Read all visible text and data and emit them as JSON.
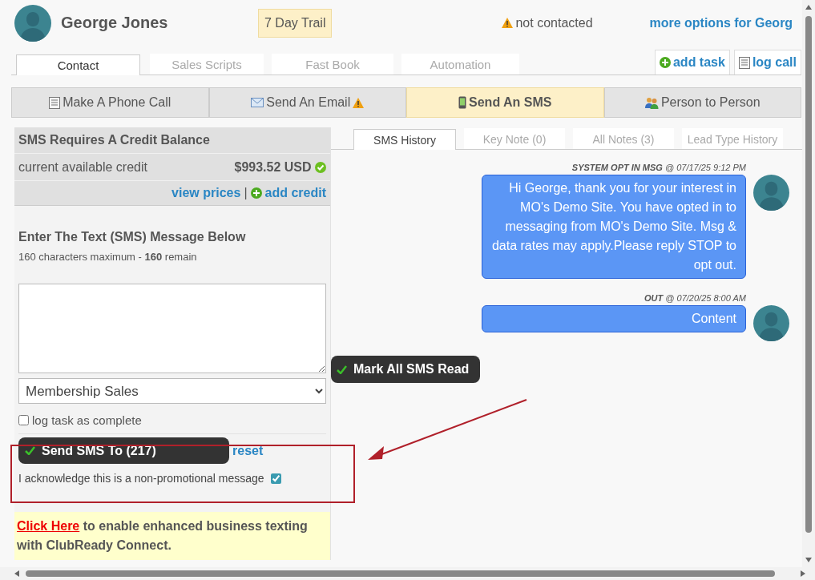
{
  "contact": {
    "name": "George Jones",
    "status_badge": "7 Day Trail",
    "contact_status": "not contacted",
    "more_options_link": "more options for Georg"
  },
  "tabs": [
    {
      "label": "Contact",
      "selected": true
    },
    {
      "label": "Sales Scripts",
      "selected": false
    },
    {
      "label": "Fast Book",
      "selected": false
    },
    {
      "label": "Automation",
      "selected": false
    }
  ],
  "quick_actions": [
    {
      "label": "add task",
      "kind": "add"
    },
    {
      "label": "log call",
      "kind": "log"
    }
  ],
  "action_bar": [
    {
      "label": "Make A Phone Call",
      "kind": "phone",
      "selected": false,
      "warning": false
    },
    {
      "label": "Send An Email",
      "kind": "email",
      "selected": false,
      "warning": true
    },
    {
      "label": "Send An SMS",
      "kind": "sms",
      "selected": true,
      "warning": false
    },
    {
      "label": "Person to Person",
      "kind": "person",
      "selected": false,
      "warning": false
    }
  ],
  "credit": {
    "title": "SMS Requires A Credit Balance",
    "label": "current available credit",
    "amount": "$993.52 USD",
    "view_link": "view prices",
    "separator": "|",
    "add_link": "add credit"
  },
  "composer": {
    "heading": "Enter The Text (SMS) Message Below",
    "limit_note": "160 characters maximum - **160** remain",
    "template": "Membership Sales",
    "log_task": {
      "label": "log task as complete",
      "checked": false
    },
    "send_button": "Send SMS To (217)",
    "reset_link": "reset",
    "acknowledge": {
      "label": "I acknowledge this is a non-promotional message",
      "checked": true
    }
  },
  "promo": {
    "link": "Click Here",
    "text": "to enable enhanced business texting with ClubReady Connect."
  },
  "history_tabs": [
    {
      "label": "SMS History",
      "selected": true
    },
    {
      "label": "Key Note (0)",
      "selected": false
    },
    {
      "label": "All Notes (3)",
      "selected": false
    },
    {
      "label": "Lead Type History",
      "selected": false
    }
  ],
  "messages": [
    {
      "sender": "SYSTEM OPT IN MSG",
      "time": "@ 07/17/25 9:12 PM",
      "text": "Hi George, thank you for your interest in MO's Demo Site. You have opted in to messaging from MO's Demo Site. Msg & data rates may apply.Please reply STOP to opt out."
    },
    {
      "sender": "OUT",
      "time": "@ 07/20/25 8:00 AM",
      "text": "Content"
    }
  ],
  "mark_read_button": "Mark All SMS Read"
}
